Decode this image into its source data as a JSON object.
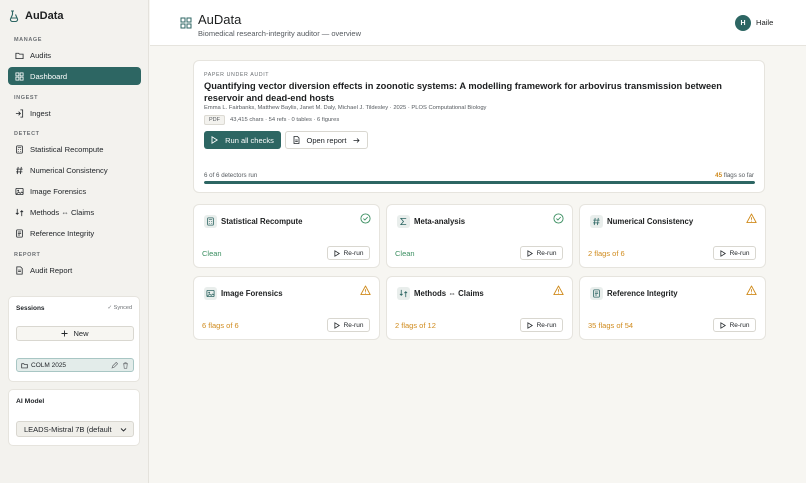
{
  "app": {
    "name": "AuData"
  },
  "sidebar": {
    "sections": {
      "manage": "MANAGE",
      "ingest": "INGEST",
      "detect": "DETECT",
      "report": "REPORT"
    },
    "items": [
      {
        "label": "Audits",
        "icon": "folder-open-icon"
      },
      {
        "label": "Dashboard",
        "icon": "dashboard-icon",
        "active": true
      },
      {
        "label": "Ingest",
        "icon": "import-icon"
      },
      {
        "label": "Statistical Recompute",
        "icon": "calculator-icon"
      },
      {
        "label": "Numerical Consistency",
        "icon": "hash-icon"
      },
      {
        "label": "Image Forensics",
        "icon": "image-icon"
      },
      {
        "label": "Methods ⇔ Claims",
        "icon": "compare-arrows-icon"
      },
      {
        "label": "Reference Integrity",
        "icon": "file-text-icon"
      },
      {
        "label": "Audit Report",
        "icon": "report-icon"
      }
    ],
    "sessions": {
      "title": "Sessions",
      "status": "✓ Synced",
      "new_label": "New",
      "items": [
        {
          "name": "COLM 2025"
        }
      ]
    },
    "ai_model": {
      "title": "AI Model",
      "selected": "LEADS-Mistral 7B (default"
    }
  },
  "header": {
    "title": "AuData",
    "subtitle": "Biomedical research-integrity auditor — overview",
    "user": {
      "initial": "H",
      "name": "Haile"
    }
  },
  "paper": {
    "eyebrow": "PAPER UNDER AUDIT",
    "title": "Quantifying vector diversion effects in zoonotic systems: A modelling framework for arbovirus transmission between reservoir and dead-end hosts",
    "authors": "Emma L. Fairbanks, Matthew Baylis, Janet M. Daly, Michael J. Tildesley · 2025 · PLOS Computational Biology",
    "format_badge": "PDF",
    "stats": "43,415 chars · 54 refs · 0 tables · 6 figures",
    "run_all_label": "Run all checks",
    "open_report_label": "Open report",
    "progress": {
      "text": "6 of 6 detectors run",
      "completed": 6,
      "total": 6,
      "flags_count": "45",
      "flags_suffix": " flags so far"
    }
  },
  "detectors": [
    {
      "name": "Statistical Recompute",
      "icon": "calculator-icon",
      "status": "ok",
      "result": "Clean",
      "rerun_label": "Re-run"
    },
    {
      "name": "Meta-analysis",
      "icon": "sigma-icon",
      "status": "ok",
      "result": "Clean",
      "rerun_label": "Re-run"
    },
    {
      "name": "Numerical Consistency",
      "icon": "hash-icon",
      "status": "warning",
      "result": "2 flags of 6",
      "rerun_label": "Re-run"
    },
    {
      "name": "Image Forensics",
      "icon": "image-icon",
      "status": "warning",
      "result": "6 flags of 6",
      "rerun_label": "Re-run"
    },
    {
      "name": "Methods ⇔ Claims",
      "icon": "compare-arrows-icon",
      "status": "warning",
      "result": "2 flags of 12",
      "rerun_label": "Re-run"
    },
    {
      "name": "Reference Integrity",
      "icon": "file-text-icon",
      "status": "warning",
      "result": "35 flags of 54",
      "rerun_label": "Re-run"
    }
  ],
  "colors": {
    "accent": "#2d6663",
    "clean": "#3a8e60",
    "warning": "#d08b1d"
  }
}
